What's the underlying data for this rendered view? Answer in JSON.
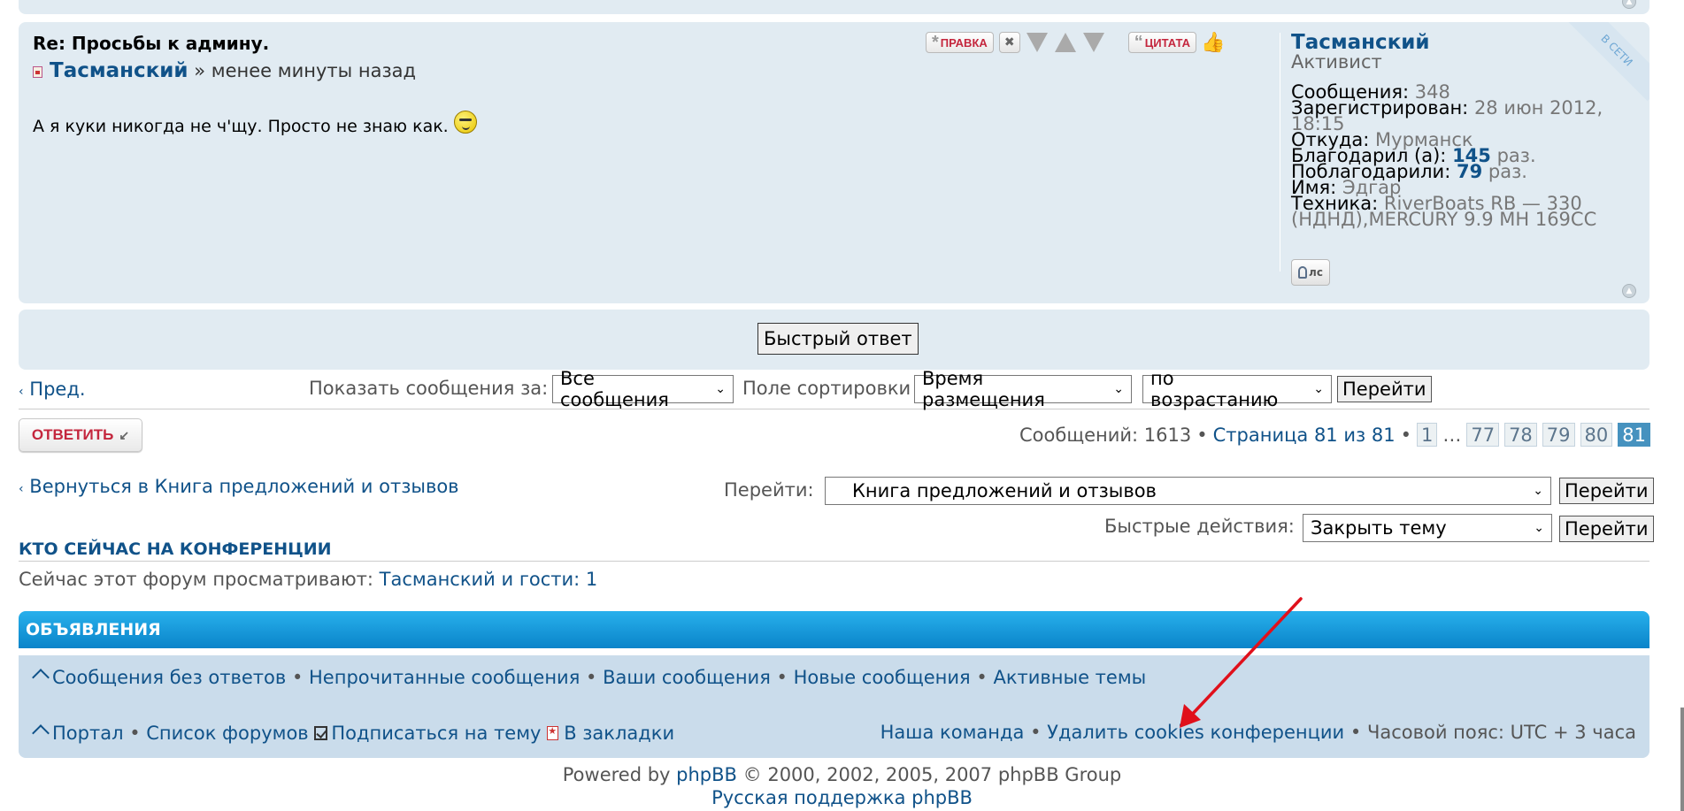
{
  "post": {
    "title": "Re: Просьбы к админу.",
    "author": "Тасманский",
    "time_sep": " » ",
    "time": "менее минуты назад",
    "body": "А я куки никогда не ч'щу. Просто не знаю как.",
    "buttons": {
      "edit": "ПРАВКА",
      "quote": "ЦИТАТА"
    },
    "profile": {
      "name": "Тасманский",
      "rank": "Активист",
      "online": "В СЕТИ",
      "posts_label": "Сообщения:",
      "posts": "348",
      "joined_label": "Зарегистрирован:",
      "joined": "28 июн 2012, 18:15",
      "from_label": "Откуда:",
      "from": "Мурманск",
      "thanked_label": "Благодарил (а):",
      "thanked": "145",
      "thanked_suffix": "раз.",
      "was_thanked_label": "Поблагодарили:",
      "was_thanked": "79",
      "was_thanked_suffix": "раз.",
      "firstname_label": "Имя:",
      "firstname": "Эдгар",
      "gear_label": "Техника:",
      "gear": "RiverBoats RB — 330 (НДНД),MERCURY 9.9 MH 169CC",
      "pm": "лс"
    }
  },
  "quick_reply": "Быстрый ответ",
  "sort": {
    "prev": "Пред.",
    "show_label": "Показать сообщения за:",
    "show_value": "Все сообщения",
    "sort_label": "Поле сортировки",
    "sort_value": "Время размещения",
    "order_value": "по возрастанию",
    "go": "Перейти"
  },
  "reply_btn": "ОТВЕТИТЬ",
  "pagination": {
    "summary": "Сообщений: 1613",
    "page_text": "Страница 81 из 81",
    "pages": [
      "1",
      "77",
      "78",
      "79",
      "80",
      "81"
    ],
    "ellipsis": "…",
    "active": "81"
  },
  "back_link": "Вернуться в Книга предложений и отзывов",
  "jump": {
    "label": "Перейти:",
    "value": "Книга предложений и отзывов",
    "go": "Перейти"
  },
  "quick_actions": {
    "label": "Быстрые действия:",
    "value": "Закрыть тему",
    "go": "Перейти"
  },
  "who": {
    "title": "КТО СЕЙЧАС НА КОНФЕРЕНЦИИ",
    "text": "Сейчас этот форум просматривают:",
    "user": "Тасманский",
    "guests": "и гости: 1"
  },
  "announcements": {
    "title": "ОБЪЯВЛЕНИЯ",
    "row1": [
      "Сообщения без ответов",
      "Непрочитанные сообщения",
      "Ваши сообщения",
      "Новые сообщения",
      "Активные темы"
    ],
    "row2_left": [
      "Портал",
      "Список форумов",
      "Подписаться на тему",
      "В закладки"
    ],
    "row2_right": [
      "Наша команда",
      "Удалить cookies конференции"
    ],
    "timezone": "Часовой пояс: UTC + 3 часа",
    "sep": "•"
  },
  "footer": {
    "powered": "Powered by",
    "phpbb": "phpBB",
    "copyright": "© 2000, 2002, 2005, 2007 phpBB Group",
    "support": "Русская поддержка phpBB"
  },
  "colors": {
    "link": "#105289",
    "post_bg": "#e1ebf2",
    "header_blue": "#0a84c9",
    "annotation_red": "#e0101b"
  }
}
